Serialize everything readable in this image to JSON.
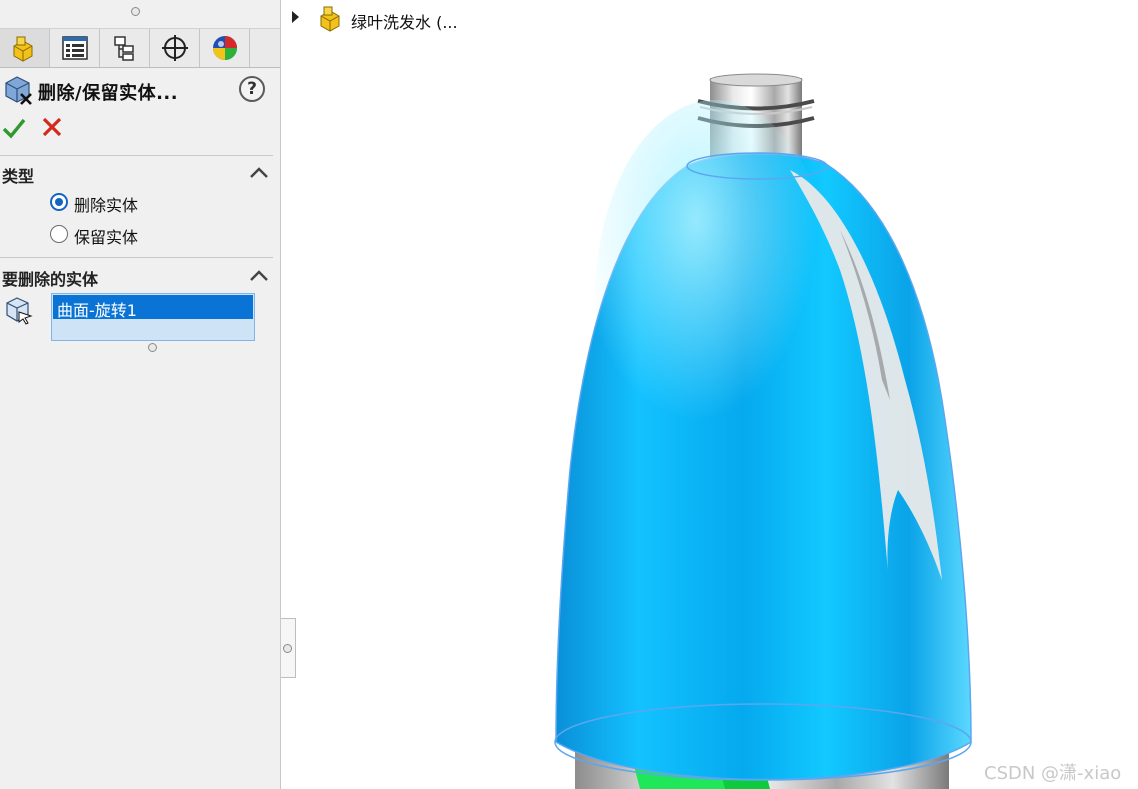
{
  "panel": {
    "tabs": [
      {
        "icon": "feature-manager-icon",
        "active": true
      },
      {
        "icon": "property-manager-icon",
        "active": false
      },
      {
        "icon": "configuration-manager-icon",
        "active": false
      },
      {
        "icon": "dimxpert-manager-icon",
        "active": false
      },
      {
        "icon": "display-manager-icon",
        "active": false
      }
    ],
    "title": "删除/保留实体...",
    "help": "?",
    "type_group": {
      "label": "类型",
      "options": [
        {
          "label": "删除实体",
          "selected": true
        },
        {
          "label": "保留实体",
          "selected": false
        }
      ]
    },
    "bodies_group": {
      "label": "要删除的实体",
      "items": [
        "曲面-旋转1"
      ]
    }
  },
  "viewport": {
    "tree_item": "绿叶洗发水 (..."
  },
  "watermark": "CSDN @潇-xiao",
  "colors": {
    "selection": "#0a74d6",
    "surface_blue": "#00b4f0",
    "ok_green": "#2e9a2e",
    "cancel_red": "#d42a1a",
    "edge_green": "#1ee85a"
  }
}
